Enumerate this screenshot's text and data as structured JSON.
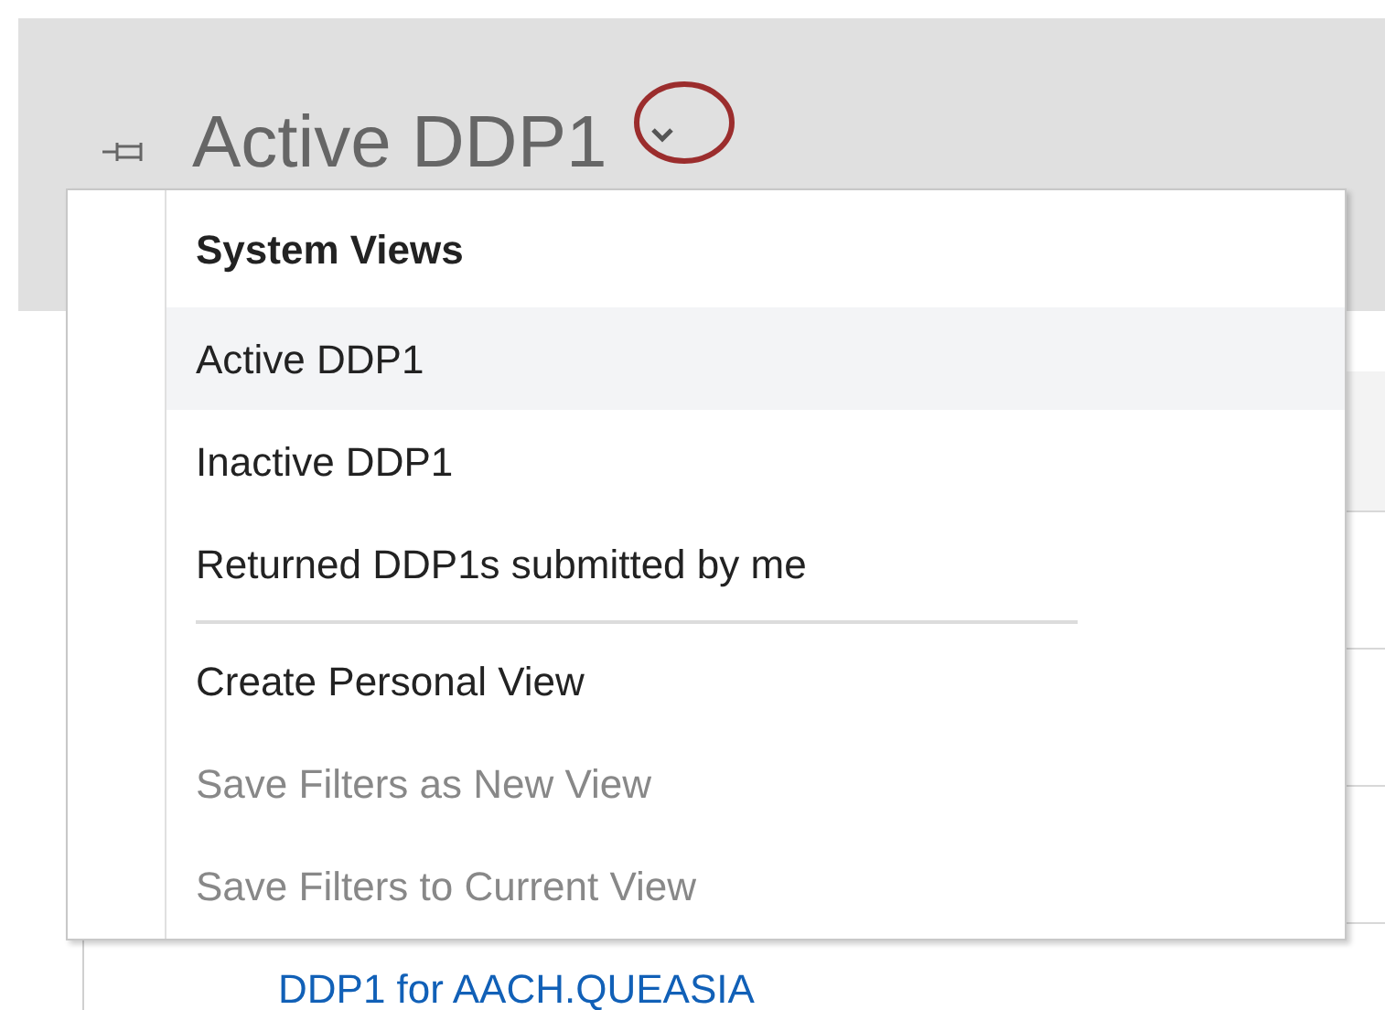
{
  "header": {
    "title": "Active DDP1"
  },
  "view_menu": {
    "groups": [
      {
        "heading": "System Views",
        "items": [
          {
            "label": "Active DDP1",
            "selected": true,
            "disabled": false
          },
          {
            "label": "Inactive DDP1",
            "selected": false,
            "disabled": false
          },
          {
            "label": "Returned DDP1s submitted by me",
            "selected": false,
            "disabled": false
          }
        ]
      },
      {
        "items": [
          {
            "label": "Create Personal View",
            "selected": false,
            "disabled": false
          },
          {
            "label": "Save Filters as New View",
            "selected": false,
            "disabled": true
          },
          {
            "label": "Save Filters to Current View",
            "selected": false,
            "disabled": true
          }
        ]
      }
    ]
  },
  "grid": {
    "link": "DDP1 for AACH.QUEASIA"
  }
}
